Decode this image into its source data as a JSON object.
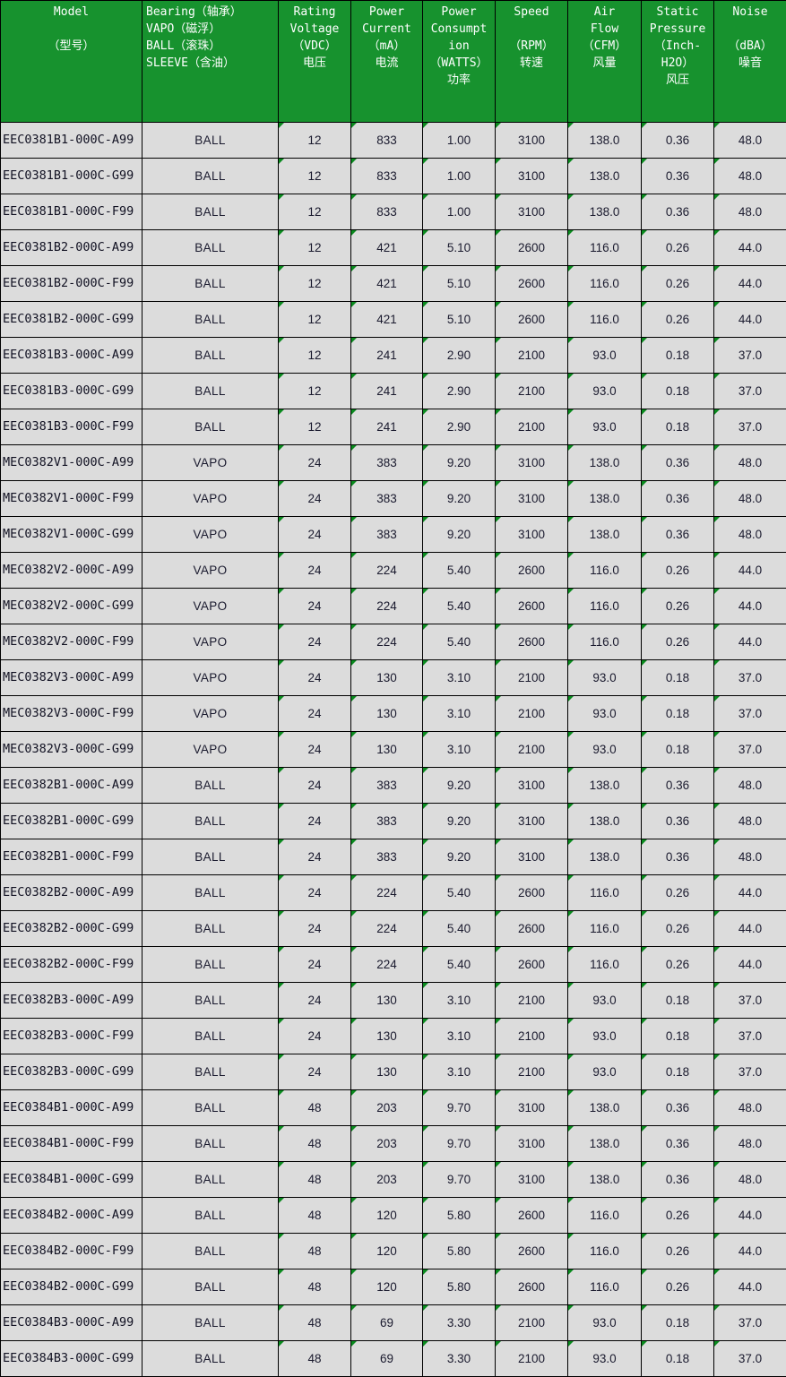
{
  "table": {
    "columns": [
      {
        "key": "model",
        "lines": [
          "Model",
          "",
          "（型号）"
        ],
        "align": "center"
      },
      {
        "key": "bearing",
        "lines": [
          "Bearing（轴承）",
          "VAPO（磁浮）",
          "BALL（滚珠）",
          "SLEEVE（含油）"
        ],
        "align": "left"
      },
      {
        "key": "voltage",
        "lines": [
          "Rating",
          "Voltage",
          "（VDC）",
          "电压"
        ],
        "align": "center"
      },
      {
        "key": "current",
        "lines": [
          "Power",
          "Current",
          "（mA）",
          "电流"
        ],
        "align": "center"
      },
      {
        "key": "watts",
        "lines": [
          "Power",
          "Consumpt",
          "ion",
          "（WATTS）",
          "功率"
        ],
        "align": "center"
      },
      {
        "key": "speed",
        "lines": [
          "Speed",
          "",
          "（RPM）",
          "转速"
        ],
        "align": "center"
      },
      {
        "key": "airflow",
        "lines": [
          "Air",
          "Flow",
          "（CFM）",
          "风量"
        ],
        "align": "center"
      },
      {
        "key": "pressure",
        "lines": [
          "Static",
          "Pressure",
          "（Inch-",
          "H2O）",
          "风压"
        ],
        "align": "center"
      },
      {
        "key": "noise",
        "lines": [
          "Noise",
          "",
          "（dBA）",
          "噪音"
        ],
        "align": "center"
      }
    ],
    "rows": [
      [
        "EEC0381B1-000C-A99",
        "BALL",
        "12",
        "833",
        "1.00",
        "3100",
        "138.0",
        "0.36",
        "48.0"
      ],
      [
        "EEC0381B1-000C-G99",
        "BALL",
        "12",
        "833",
        "1.00",
        "3100",
        "138.0",
        "0.36",
        "48.0"
      ],
      [
        "EEC0381B1-000C-F99",
        "BALL",
        "12",
        "833",
        "1.00",
        "3100",
        "138.0",
        "0.36",
        "48.0"
      ],
      [
        "EEC0381B2-000C-A99",
        "BALL",
        "12",
        "421",
        "5.10",
        "2600",
        "116.0",
        "0.26",
        "44.0"
      ],
      [
        "EEC0381B2-000C-F99",
        "BALL",
        "12",
        "421",
        "5.10",
        "2600",
        "116.0",
        "0.26",
        "44.0"
      ],
      [
        "EEC0381B2-000C-G99",
        "BALL",
        "12",
        "421",
        "5.10",
        "2600",
        "116.0",
        "0.26",
        "44.0"
      ],
      [
        "EEC0381B3-000C-A99",
        "BALL",
        "12",
        "241",
        "2.90",
        "2100",
        "93.0",
        "0.18",
        "37.0"
      ],
      [
        "EEC0381B3-000C-G99",
        "BALL",
        "12",
        "241",
        "2.90",
        "2100",
        "93.0",
        "0.18",
        "37.0"
      ],
      [
        "EEC0381B3-000C-F99",
        "BALL",
        "12",
        "241",
        "2.90",
        "2100",
        "93.0",
        "0.18",
        "37.0"
      ],
      [
        "MEC0382V1-000C-A99",
        "VAPO",
        "24",
        "383",
        "9.20",
        "3100",
        "138.0",
        "0.36",
        "48.0"
      ],
      [
        "MEC0382V1-000C-F99",
        "VAPO",
        "24",
        "383",
        "9.20",
        "3100",
        "138.0",
        "0.36",
        "48.0"
      ],
      [
        "MEC0382V1-000C-G99",
        "VAPO",
        "24",
        "383",
        "9.20",
        "3100",
        "138.0",
        "0.36",
        "48.0"
      ],
      [
        "MEC0382V2-000C-A99",
        "VAPO",
        "24",
        "224",
        "5.40",
        "2600",
        "116.0",
        "0.26",
        "44.0"
      ],
      [
        "MEC0382V2-000C-G99",
        "VAPO",
        "24",
        "224",
        "5.40",
        "2600",
        "116.0",
        "0.26",
        "44.0"
      ],
      [
        "MEC0382V2-000C-F99",
        "VAPO",
        "24",
        "224",
        "5.40",
        "2600",
        "116.0",
        "0.26",
        "44.0"
      ],
      [
        "MEC0382V3-000C-A99",
        "VAPO",
        "24",
        "130",
        "3.10",
        "2100",
        "93.0",
        "0.18",
        "37.0"
      ],
      [
        "MEC0382V3-000C-F99",
        "VAPO",
        "24",
        "130",
        "3.10",
        "2100",
        "93.0",
        "0.18",
        "37.0"
      ],
      [
        "MEC0382V3-000C-G99",
        "VAPO",
        "24",
        "130",
        "3.10",
        "2100",
        "93.0",
        "0.18",
        "37.0"
      ],
      [
        "EEC0382B1-000C-A99",
        "BALL",
        "24",
        "383",
        "9.20",
        "3100",
        "138.0",
        "0.36",
        "48.0"
      ],
      [
        "EEC0382B1-000C-G99",
        "BALL",
        "24",
        "383",
        "9.20",
        "3100",
        "138.0",
        "0.36",
        "48.0"
      ],
      [
        "EEC0382B1-000C-F99",
        "BALL",
        "24",
        "383",
        "9.20",
        "3100",
        "138.0",
        "0.36",
        "48.0"
      ],
      [
        "EEC0382B2-000C-A99",
        "BALL",
        "24",
        "224",
        "5.40",
        "2600",
        "116.0",
        "0.26",
        "44.0"
      ],
      [
        "EEC0382B2-000C-G99",
        "BALL",
        "24",
        "224",
        "5.40",
        "2600",
        "116.0",
        "0.26",
        "44.0"
      ],
      [
        "EEC0382B2-000C-F99",
        "BALL",
        "24",
        "224",
        "5.40",
        "2600",
        "116.0",
        "0.26",
        "44.0"
      ],
      [
        "EEC0382B3-000C-A99",
        "BALL",
        "24",
        "130",
        "3.10",
        "2100",
        "93.0",
        "0.18",
        "37.0"
      ],
      [
        "EEC0382B3-000C-F99",
        "BALL",
        "24",
        "130",
        "3.10",
        "2100",
        "93.0",
        "0.18",
        "37.0"
      ],
      [
        "EEC0382B3-000C-G99",
        "BALL",
        "24",
        "130",
        "3.10",
        "2100",
        "93.0",
        "0.18",
        "37.0"
      ],
      [
        "EEC0384B1-000C-A99",
        "BALL",
        "48",
        "203",
        "9.70",
        "3100",
        "138.0",
        "0.36",
        "48.0"
      ],
      [
        "EEC0384B1-000C-F99",
        "BALL",
        "48",
        "203",
        "9.70",
        "3100",
        "138.0",
        "0.36",
        "48.0"
      ],
      [
        "EEC0384B1-000C-G99",
        "BALL",
        "48",
        "203",
        "9.70",
        "3100",
        "138.0",
        "0.36",
        "48.0"
      ],
      [
        "EEC0384B2-000C-A99",
        "BALL",
        "48",
        "120",
        "5.80",
        "2600",
        "116.0",
        "0.26",
        "44.0"
      ],
      [
        "EEC0384B2-000C-F99",
        "BALL",
        "48",
        "120",
        "5.80",
        "2600",
        "116.0",
        "0.26",
        "44.0"
      ],
      [
        "EEC0384B2-000C-G99",
        "BALL",
        "48",
        "120",
        "5.80",
        "2600",
        "116.0",
        "0.26",
        "44.0"
      ],
      [
        "EEC0384B3-000C-A99",
        "BALL",
        "48",
        "69",
        "3.30",
        "2100",
        "93.0",
        "0.18",
        "37.0"
      ],
      [
        "EEC0384B3-000C-G99",
        "BALL",
        "48",
        "69",
        "3.30",
        "2100",
        "93.0",
        "0.18",
        "37.0"
      ]
    ]
  },
  "colors": {
    "header_background": "#17922e",
    "header_text": "#ffffff",
    "cell_background": "#dcdcdc",
    "cell_text": "#1a1a2e",
    "grid_line": "#000000",
    "error_flag": "#0a8a1e"
  }
}
